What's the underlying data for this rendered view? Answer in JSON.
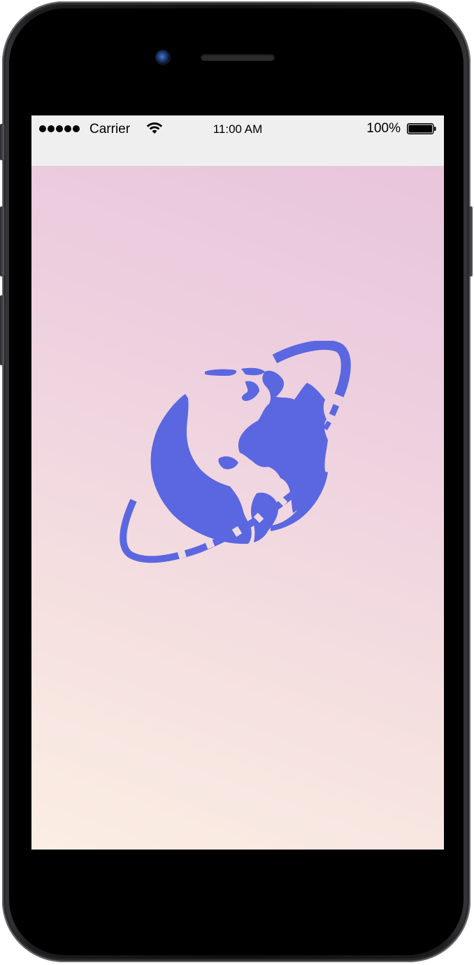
{
  "status_bar": {
    "carrier": "Carrier",
    "time": "11:00 AM",
    "battery_percent": "100%",
    "signal_bars": 5
  },
  "splash": {
    "logo_icon": "globe-with-orbit-icon",
    "logo_color": "#5a67e0"
  },
  "colors": {
    "gradient_top": "#e8c3da",
    "gradient_bottom": "#fbeee3",
    "status_bar_bg": "#efeff0",
    "device_frame": "#1c1c1e"
  }
}
